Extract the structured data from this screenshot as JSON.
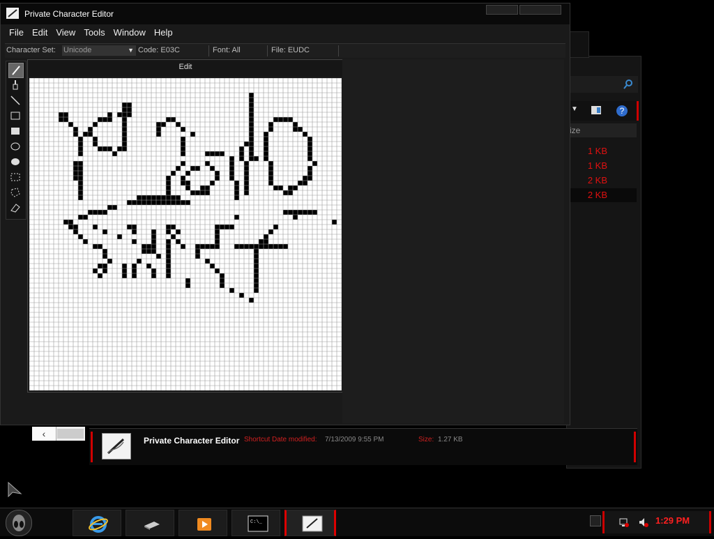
{
  "app": {
    "title": "Private Character Editor"
  },
  "menu": [
    "File",
    "Edit",
    "View",
    "Tools",
    "Window",
    "Help"
  ],
  "infobar": {
    "charset_label": "Character Set:",
    "charset_value": "Unicode",
    "code": "Code: E03C",
    "font": "Font: All",
    "file": "File: EUDC"
  },
  "tools": [
    "pencil-icon",
    "brush-icon",
    "line-icon",
    "hollow-rectangle-icon",
    "filled-rectangle-icon",
    "hollow-ellipse-icon",
    "filled-ellipse-icon",
    "rectangular-selection-icon",
    "freeform-selection-icon",
    "eraser-icon"
  ],
  "edit_panel": {
    "title": "Edit"
  },
  "grid": {
    "cols": 64,
    "rows": 64,
    "drawing": [
      "................................................................",
      "................................................................",
      "................................................................",
      ".............................................#..................",
      ".............................................#..................",
      "...................##........................#..................",
      "...................##........................#..................",
      "......##........#.###........................#..................",
      "......##......###..#........##...............#....####..........",
      "........#....#.....#......##..#..............#...#....#.........",
      ".........#..#......#......#....#.............#...#....##........",
      ".........#.##......#......#......#...........#..#.......#........",
      "..........#..#.....#...........#.............#..#........#......",
      "..........#..#.....#...........#............##..#........#......",
      "..........#...###.##...........#...........#.#..#........#......",
      "..........#......#.............#....####...#.#..#........#......",
      ".........................................#.#.##.#........#......",
      ".........##....................#....#....#..#....#........#......",
      ".........##...................#..##..#...#..#....#.......#.......",
      ".........##..................#..#.....#..#..#....#.......#.......",
      ".........##.................#..#......#..#..#....#......##......",
      "..........#.................#..##....#....#.#....#.....##.......",
      "..........#.................#...#..##.....#.#.....##.##.........",
      "..........#.................#....####.....#.#.......##..........",
      "..........#...........#########...........#.....................",
      "....................#############...............................",
      "................##..............................................",
      "............####....................................#######.....",
      "..........##..............................#...........#.........",
      ".......##.....................................................#.",
      "........##...#......##......##........####........#.............",
      ".........#.....#.....#...#..#.#.......#..........#..............",
      "..........#.......#......#...#........#.........#...............",
      "...........#.........#...#..#.#.......#........##...............",
      ".............##........###..#..#..#####...###########...........",
      "...............#.......###..#.....#...........#.................",
      "...............#..........#.#.....#...........#.................",
      "................#.....#.....#.......#.........#.................",
      "..............##...#.#..#...#........#........#.................",
      ".............#.#...#.#...#..#.........#.......#.................",
      "..............#....#.#...#..#..........#......#.................",
      "................................#......#......#.................",
      "................................#......#......#.................",
      ".........................................#....#.................",
      "...........................................#....................",
      ".............................................#..................",
      "................................................................",
      "................................................................",
      "................................................................",
      "................................................................",
      "................................................................",
      "................................................................",
      "................................................................",
      "................................................................",
      "................................................................",
      "................................................................",
      "................................................................",
      "................................................................",
      "................................................................",
      "................................................................",
      "................................................................",
      "................................................................",
      "................................................................",
      "................................................................"
    ]
  },
  "explorer": {
    "column_header": "ize",
    "rows": [
      "1 KB",
      "1 KB",
      "2 KB",
      "2 KB"
    ]
  },
  "details": {
    "name": "Private Character Editor",
    "type_label": "Shortcut",
    "date_label": "Date modified:",
    "date_value": "7/13/2009 9:55 PM",
    "size_label": "Size:",
    "size_value": "1.27 KB"
  },
  "taskbar": {
    "clock": "1:29 PM",
    "buttons": [
      "internet-explorer-icon",
      "window-switcher-icon",
      "media-player-icon",
      "command-prompt-icon",
      "private-character-editor-icon"
    ]
  },
  "colors": {
    "accent": "#d00000",
    "clock": "#ff2020",
    "grid_on": "#000000",
    "grid_off": "#ffffff"
  }
}
